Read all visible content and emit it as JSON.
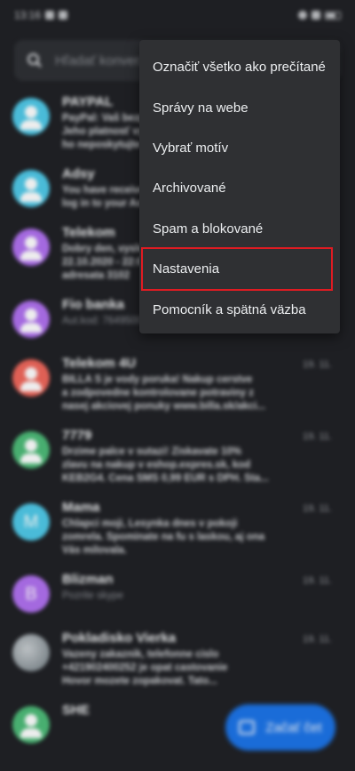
{
  "status_bar": {
    "time": "13:16"
  },
  "search": {
    "placeholder": "Hľadať konverzácie"
  },
  "conversations": [
    {
      "name": "PAYPAL",
      "snippet": "PayPal: Vaš bezpečnostný kód\nJeho platnosť vyprší o 10 minút\nho neposkytujte",
      "time": "",
      "avatar": "person",
      "color": "#4ec9e8",
      "bold": true
    },
    {
      "name": "Adsy",
      "snippet": "You have received a new message\nlog in to your Account",
      "time": "",
      "avatar": "person",
      "color": "#4ec9e8",
      "bold": true
    },
    {
      "name": "Telekom",
      "snippet": "Dobry den, vysledok objednavky\n22.10.2020 - 22:00\nadresata 3102",
      "time": "",
      "avatar": "person",
      "color": "#b070f0",
      "bold": true
    },
    {
      "name": "Fio banka",
      "snippet": "Aut.kod: 76495002 pre pokyn c. 6658385068...",
      "time": "",
      "avatar": "person",
      "color": "#b070f0",
      "bold": false
    },
    {
      "name": "Telekom 4U",
      "snippet": "BILLA S je vody poruka! Nakup cerstve\na zodpovedne kontrolovane potraviny z\nnasej akciovej ponuky www.billa.sk/akci...",
      "time": "19. 11.",
      "avatar": "person",
      "color": "#f0665a",
      "bold": true
    },
    {
      "name": "7779",
      "snippet": "Drzime palce v sutazi! Ziskavate 10%\nzlavu na nakup v eshop.expres.sk, kod\nKEB2G4. Cena SMS 0,99 EUR s DPH. Sta...",
      "time": "19. 11.",
      "avatar": "person",
      "color": "#4cbb77",
      "bold": true
    },
    {
      "name": "Mama",
      "snippet": "Chlapci moji, Lesynka dnes v pokoji\nzomrela. Spominate na fu s laskou, aj ona\nVás milovala.",
      "time": "19. 11.",
      "avatar": "letter",
      "letter": "M",
      "color": "#4ec9e8",
      "bold": true
    },
    {
      "name": "Blizman",
      "snippet": "Pozrite skype",
      "time": "19. 11.",
      "avatar": "letter",
      "letter": "B",
      "color": "#b070f0",
      "bold": false
    },
    {
      "name": "Pokladisko Vierka",
      "snippet": "Vazeny zakaznik, telefonne cislo\n+421902400252 je opat castovanie\nHovor mozete zopakovat. Tato...",
      "time": "19. 11.",
      "avatar": "photo",
      "color": "#9aa3a8",
      "bold": true
    },
    {
      "name": "SHE",
      "snippet": "",
      "time": "",
      "avatar": "person",
      "color": "#4cbb77",
      "bold": true
    }
  ],
  "menu": {
    "items": [
      {
        "label": "Označiť všetko ako prečítané"
      },
      {
        "label": "Správy na webe"
      },
      {
        "label": "Vybrať motív"
      },
      {
        "label": "Archivované"
      },
      {
        "label": "Spam a blokované"
      },
      {
        "label": "Nastavenia",
        "highlighted": true
      },
      {
        "label": "Pomocník a spätná väzba"
      }
    ]
  },
  "fab": {
    "label": "Začať čet",
    "icon": "chat-add-icon"
  },
  "colors": {
    "accent": "#1a73e8",
    "highlight_box": "#e01b22",
    "menu_bg": "#2f3033",
    "background": "#1e1f23"
  }
}
